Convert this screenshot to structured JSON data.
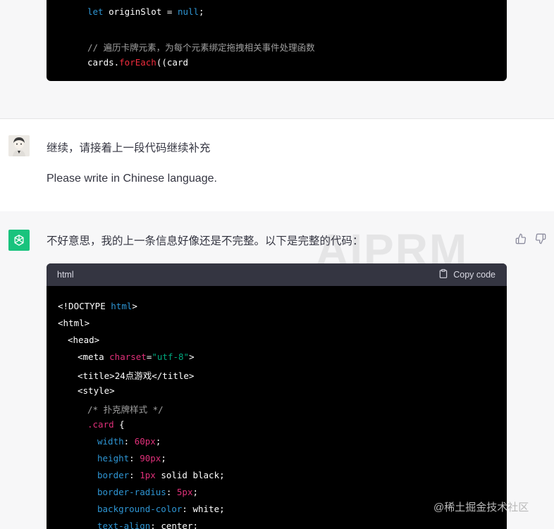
{
  "top_code": {
    "line1": {
      "kw": "let",
      "rest1": " originSlot = ",
      "val": "null",
      "rest2": ";"
    },
    "comment": "// 遍历卡牌元素，为每个元素绑定拖拽相关事件处理函数",
    "line3": {
      "pre": "cards.",
      "fn": "forEach",
      "post": "((card"
    }
  },
  "user_message": {
    "line1": "继续，请接着上一段代码继续补充",
    "line2": "Please write in Chinese language."
  },
  "assistant": {
    "intro": "不好意思，我的上一条信息好像还是不完整。以下是完整的代码：",
    "watermark": "AIPRM",
    "code_block": {
      "language": "html",
      "copy_label": "Copy code",
      "lines": {
        "l1a": "<!DOCTYPE ",
        "l1b": "html",
        "l1c": ">",
        "l2": "<html>",
        "l3": "<head>",
        "l4a": "<meta ",
        "l4b": "charset",
        "l4c": "=",
        "l4d": "\"utf-8\"",
        "l4e": ">",
        "l5a": "<title>",
        "l5b": "24点游戏",
        "l5c": "</title>",
        "l6": "<style>",
        "l7": "/* 扑克牌样式 */",
        "l8a": ".card",
        "l8b": " {",
        "l9a": "width",
        "l9b": ": ",
        "l9c": "60px",
        "l9d": ";",
        "l10a": "height",
        "l10b": ": ",
        "l10c": "90px",
        "l10d": ";",
        "l11a": "border",
        "l11b": ": ",
        "l11c": "1px",
        "l11d": " solid black;",
        "l12a": "border-radius",
        "l12b": ": ",
        "l12c": "5px",
        "l12d": ";",
        "l13a": "background-color",
        "l13b": ": white;",
        "l14a": "text-align",
        "l14b": ": center;"
      }
    }
  },
  "credit": "@稀土掘金技术社区",
  "colors": {
    "accent": "#19c37d",
    "code_bg": "#000000",
    "code_header": "#343541"
  }
}
